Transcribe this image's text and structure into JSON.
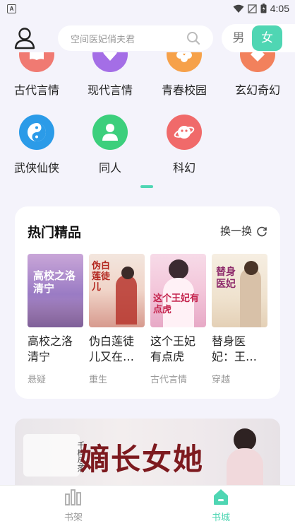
{
  "status": {
    "time": "4:05",
    "left_icon": "a-icon"
  },
  "search": {
    "placeholder": "空间医妃俏夫君"
  },
  "gender": {
    "male": "男",
    "female": "女",
    "selected": "female"
  },
  "categories": [
    {
      "label": "古代言情",
      "color": "#f07a72",
      "icon": "book-icon"
    },
    {
      "label": "现代言情",
      "color": "#a46ee6",
      "icon": "heart-icon"
    },
    {
      "label": "青春校园",
      "color": "#f6a14a",
      "icon": "flower-icon"
    },
    {
      "label": "玄幻奇幻",
      "color": "#f2815c",
      "icon": "diamond-icon"
    },
    {
      "label": "武侠仙侠",
      "color": "#2b9be8",
      "icon": "yinyang-icon"
    },
    {
      "label": "同人",
      "color": "#3ccf7c",
      "icon": "person-icon"
    },
    {
      "label": "科幻",
      "color": "#f06a6a",
      "icon": "planet-icon"
    }
  ],
  "hot": {
    "title": "热门精品",
    "refresh": "换一换",
    "books": [
      {
        "title": "高校之洛清宁",
        "tag": "悬疑",
        "cover_text": "高校之洛清宁"
      },
      {
        "title": "伪白莲徒儿又在…",
        "tag": "重生",
        "cover_text": "伪白莲徒儿"
      },
      {
        "title": "这个王妃有点虎",
        "tag": "古代言情",
        "cover_text": "这个王妃有点虎"
      },
      {
        "title": "替身医妃：王…",
        "tag": "穿越",
        "cover_text": "替身医妃"
      }
    ]
  },
  "banner": {
    "headline": "嫡长女她",
    "side_text": "千桦尽落"
  },
  "nav": {
    "bookshelf": "书架",
    "bookcity": "书城",
    "active_color": "#4fd6b3"
  }
}
